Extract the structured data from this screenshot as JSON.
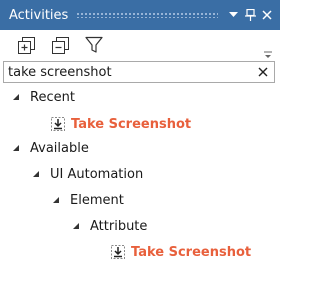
{
  "panel": {
    "title": "Activities"
  },
  "toolbar": {
    "expand_all": "expand-all-icon",
    "collapse_all": "collapse-all-icon",
    "filter": "filter-icon"
  },
  "search": {
    "value": "take screenshot"
  },
  "tree": {
    "recent": {
      "label": "Recent",
      "children": [
        {
          "label": "Take Screenshot"
        }
      ]
    },
    "available": {
      "label": "Available",
      "ui_automation": {
        "label": "UI Automation",
        "element": {
          "label": "Element",
          "attribute": {
            "label": "Attribute",
            "children": [
              {
                "label": "Take Screenshot"
              }
            ]
          }
        }
      }
    }
  },
  "colors": {
    "title_bar": "#3a6ea5",
    "match_highlight": "#e8603c"
  }
}
